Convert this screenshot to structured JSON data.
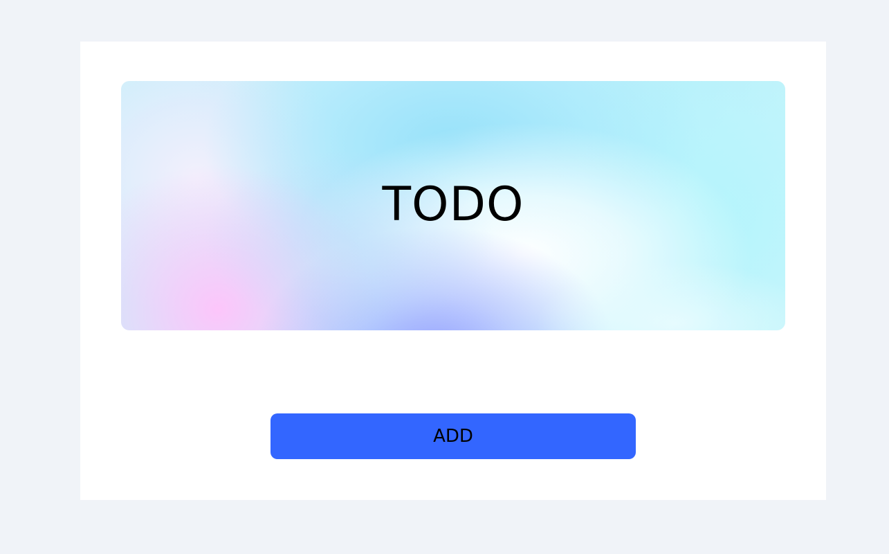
{
  "hero": {
    "title": "TODO"
  },
  "actions": {
    "add_label": "ADD"
  },
  "colors": {
    "page_background": "#f0f3f8",
    "card_background": "#ffffff",
    "accent": "#3366ff",
    "text": "#000000"
  }
}
